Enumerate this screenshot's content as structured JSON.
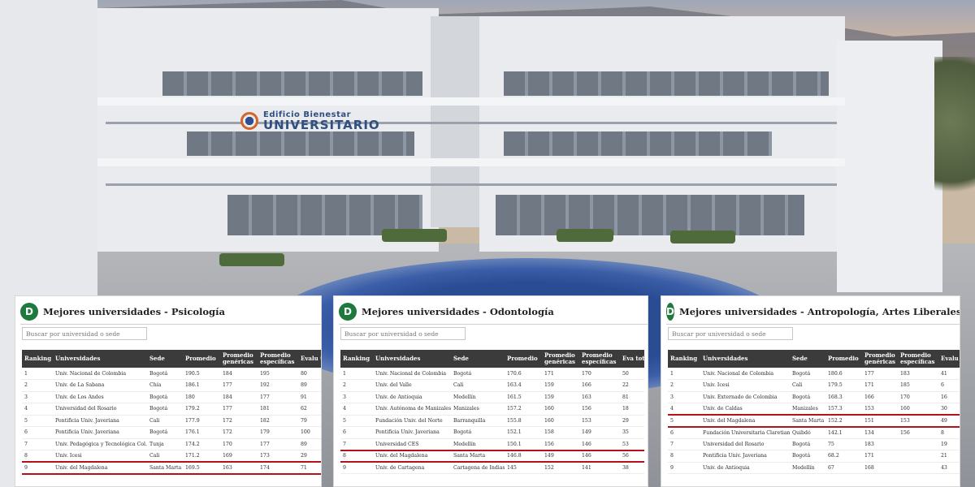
{
  "campus_sign": {
    "line1": "Edificio Bienestar",
    "line2": "UNIVERSITARIO"
  },
  "panels": [
    {
      "id": "psicologia",
      "title": "Mejores universidades - Psicología",
      "search_placeholder": "Buscar por universidad o sede",
      "columns": [
        "Ranking",
        "Universidades",
        "Sede",
        "Promedio",
        "Promedio genéricas",
        "Promedio específicas",
        "Evalu total"
      ],
      "highlight_row": 8,
      "rows": [
        [
          "1",
          "Univ. Nacional de Colombia",
          "Bogotá",
          "190.5",
          "184",
          "195",
          "80"
        ],
        [
          "2",
          "Univ. de La Sabana",
          "Chía",
          "186.1",
          "177",
          "192",
          "89"
        ],
        [
          "3",
          "Univ. de Los Andes",
          "Bogotá",
          "180",
          "184",
          "177",
          "91"
        ],
        [
          "4",
          "Universidad del Rosario",
          "Bogotá",
          "179.2",
          "177",
          "181",
          "62"
        ],
        [
          "5",
          "Pontificia Univ. Javeriana",
          "Cali",
          "177.9",
          "172",
          "182",
          "79"
        ],
        [
          "6",
          "Pontificia Univ. Javeriana",
          "Bogotá",
          "176.1",
          "172",
          "179",
          "100"
        ],
        [
          "7",
          "Univ. Pedagógica y Tecnológica Col.",
          "Tunja",
          "174.2",
          "170",
          "177",
          "89"
        ],
        [
          "8",
          "Univ. Icesi",
          "Cali",
          "171.2",
          "169",
          "173",
          "29"
        ],
        [
          "9",
          "Univ. del Magdalena",
          "Santa Marta",
          "169.5",
          "163",
          "174",
          "71"
        ]
      ]
    },
    {
      "id": "odontologia",
      "title": "Mejores universidades - Odontología",
      "search_placeholder": "Buscar por universidad o sede",
      "columns": [
        "Ranking",
        "Universidades",
        "Sede",
        "Promedio",
        "Promedio genéricas",
        "Promedio específicas",
        "Eva tota"
      ],
      "highlight_row": 7,
      "rows": [
        [
          "1",
          "Univ. Nacional de Colombia",
          "Bogotá",
          "170.6",
          "171",
          "170",
          "50"
        ],
        [
          "2",
          "Univ. del Valle",
          "Cali",
          "163.4",
          "159",
          "166",
          "22"
        ],
        [
          "3",
          "Univ. de Antioquia",
          "Medellín",
          "161.5",
          "159",
          "163",
          "81"
        ],
        [
          "4",
          "Univ. Autónoma de Manizales",
          "Manizales",
          "157.2",
          "160",
          "156",
          "18"
        ],
        [
          "5",
          "Fundación Univ. del Norte",
          "Barranquilla",
          "155.8",
          "160",
          "153",
          "29"
        ],
        [
          "6",
          "Pontificia Univ. Javeriana",
          "Bogotá",
          "152.1",
          "158",
          "149",
          "35"
        ],
        [
          "7",
          "Universidad CES",
          "Medellín",
          "150.1",
          "156",
          "146",
          "53"
        ],
        [
          "8",
          "Univ. del Magdalena",
          "Santa Marta",
          "146.8",
          "149",
          "146",
          "56"
        ],
        [
          "9",
          "Univ. de Cartagena",
          "Cartagena de Indias",
          "145",
          "152",
          "141",
          "38"
        ]
      ]
    },
    {
      "id": "antropologia",
      "title": "Mejores universidades - Antropología, Artes Liberales",
      "search_placeholder": "Buscar por universidad o sede",
      "columns": [
        "Ranking",
        "Universidades",
        "Sede",
        "Promedio",
        "Promedio genéricas",
        "Promedio específicas",
        "Evalu total"
      ],
      "highlight_row": 4,
      "rows": [
        [
          "1",
          "Univ. Nacional de Colombia",
          "Bogotá",
          "180.6",
          "177",
          "183",
          "41"
        ],
        [
          "2",
          "Univ. Icesi",
          "Cali",
          "179.5",
          "171",
          "185",
          "6"
        ],
        [
          "3",
          "Univ. Externado de Colombia",
          "Bogotá",
          "168.3",
          "166",
          "170",
          "16"
        ],
        [
          "4",
          "Univ. de Caldas",
          "Manizales",
          "157.3",
          "153",
          "160",
          "30"
        ],
        [
          "5",
          "Univ. del Magdalena",
          "Santa Marta",
          "152.2",
          "151",
          "153",
          "49"
        ],
        [
          "6",
          "Fundación Universitaria Claretiana",
          "Quibdó",
          "142.1",
          "134",
          "156",
          "8"
        ],
        [
          "7",
          "Universidad del Rosario",
          "Bogotá",
          "75",
          "183",
          "",
          "19"
        ],
        [
          "8",
          "Pontificia Univ. Javeriana",
          "Bogotá",
          "68.2",
          "171",
          "",
          "21"
        ],
        [
          "9",
          "Univ. de Antioquia",
          "Medellín",
          "67",
          "168",
          "",
          "43"
        ]
      ]
    }
  ]
}
